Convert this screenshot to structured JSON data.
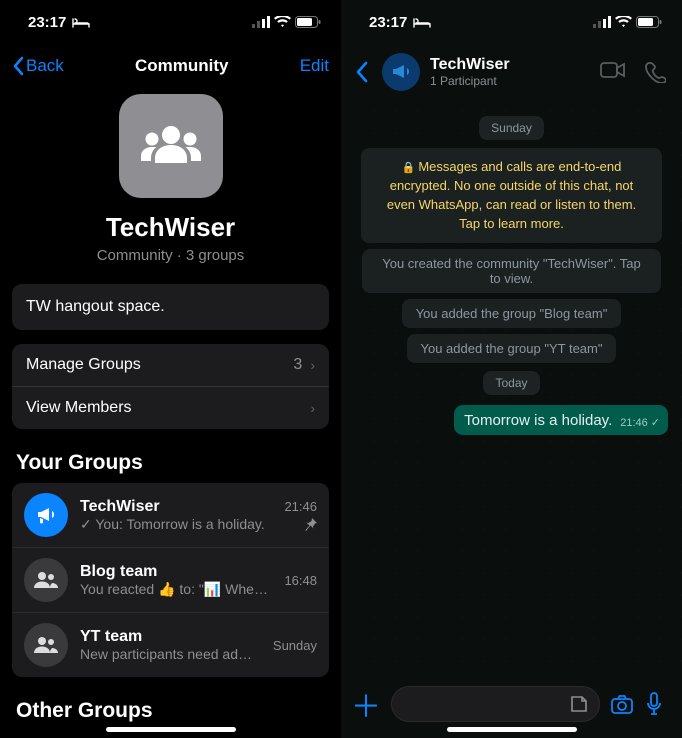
{
  "left": {
    "status": {
      "time": "23:17"
    },
    "nav": {
      "back": "Back",
      "title": "Community",
      "edit": "Edit"
    },
    "community": {
      "name": "TechWiser",
      "subtitle": "Community · 3 groups",
      "description": "TW hangout space."
    },
    "menu": {
      "manage": {
        "label": "Manage Groups",
        "count": "3"
      },
      "members": {
        "label": "View Members"
      }
    },
    "yourGroupsTitle": "Your Groups",
    "groups": [
      {
        "name": "TechWiser",
        "msg": "✓ You: Tomorrow is a holiday.",
        "time": "21:46",
        "pinned": true
      },
      {
        "name": "Blog team",
        "msg": "You reacted 👍 to: \"📊 Where...",
        "time": "16:48"
      },
      {
        "name": "YT team",
        "msg": "New participants need admin a...",
        "time": "Sunday"
      }
    ],
    "otherGroupsTitle": "Other Groups"
  },
  "right": {
    "status": {
      "time": "23:17"
    },
    "header": {
      "title": "TechWiser",
      "subtitle": "1 Participant"
    },
    "dates": {
      "d1": "Sunday",
      "d2": "Today"
    },
    "encryption": "Messages and calls are end-to-end encrypted. No one outside of this chat, not even WhatsApp, can read or listen to them. Tap to learn more.",
    "sys": [
      "You created the community \"TechWiser\". Tap to view.",
      "You added the group \"Blog team\"",
      "You added the group \"YT team\""
    ],
    "message": {
      "text": "Tomorrow is a holiday.",
      "time": "21:46"
    }
  }
}
